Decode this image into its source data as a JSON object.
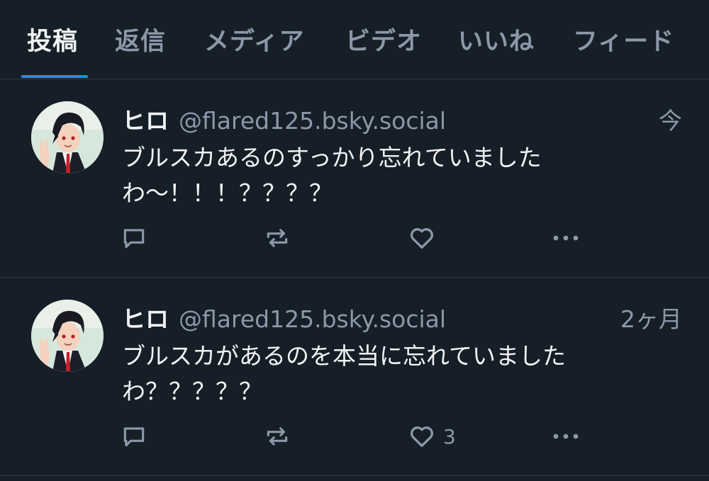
{
  "tabs": [
    {
      "label": "投稿",
      "active": true
    },
    {
      "label": "返信",
      "active": false
    },
    {
      "label": "メディア",
      "active": false
    },
    {
      "label": "ビデオ",
      "active": false
    },
    {
      "label": "いいね",
      "active": false
    },
    {
      "label": "フィード",
      "active": false
    }
  ],
  "posts": [
    {
      "display_name": "ヒロ",
      "handle": "@flared125.bsky.social",
      "timestamp": "今",
      "text": "ブルスカあるのすっかり忘れていましたわ〜！！！？？？？",
      "like_count": ""
    },
    {
      "display_name": "ヒロ",
      "handle": "@flared125.bsky.social",
      "timestamp": "2ヶ月",
      "text": "ブルスカがあるのを本当に忘れていましたわ？？？？？",
      "like_count": "3"
    }
  ],
  "icons": {
    "reply": "speech-bubble-icon",
    "repost": "repost-arrows-icon",
    "like": "heart-icon",
    "more": "ellipsis-icon"
  },
  "colors": {
    "background": "#161e27",
    "accent": "#208bfe",
    "muted": "#8b98a8",
    "text": "#f1f3f5",
    "divider": "#2e3a48"
  }
}
